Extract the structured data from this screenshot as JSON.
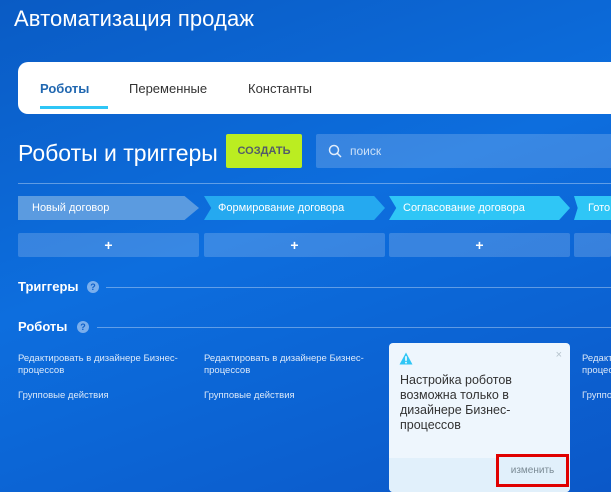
{
  "app_title": "Автоматизация продаж",
  "tabs": [
    {
      "label": "Роботы",
      "active": true
    },
    {
      "label": "Переменные",
      "active": false
    },
    {
      "label": "Константы",
      "active": false
    }
  ],
  "section_title": "Роботы и триггеры",
  "create_button": "СОЗДАТЬ",
  "search": {
    "placeholder": "поиск"
  },
  "stages": [
    {
      "label": "Новый договор",
      "color": "#5b9be0"
    },
    {
      "label": "Формирование договора",
      "color": "#25a9f0"
    },
    {
      "label": "Согласование договора",
      "color": "#2fc6f6"
    },
    {
      "label": "Гото",
      "color": "#2fc6f6"
    }
  ],
  "add_symbol": "+",
  "triggers_heading": "Триггеры",
  "robots_heading": "Роботы",
  "help_glyph": "?",
  "columns": [
    {
      "edit_line1": "Редактировать в дизайнере Бизнес-",
      "edit_line2": "процессов",
      "group": "Групповые действия"
    },
    {
      "edit_line1": "Редактировать в дизайнере Бизнес-",
      "edit_line2": "процессов",
      "group": "Групповые действия"
    },
    {
      "edit_line1": "Редакт",
      "edit_line2": "процес",
      "group": "Группо"
    }
  ],
  "popup": {
    "icon": "warning-icon",
    "close": "×",
    "text": "Настройка роботов возможна только в дизайнере Бизнес-процессов",
    "change_button": "изменить"
  },
  "colors": {
    "background": "#0d6ede",
    "create_button": "#bbed21",
    "tab_active": "#2067b0",
    "highlight": "#e00000"
  }
}
